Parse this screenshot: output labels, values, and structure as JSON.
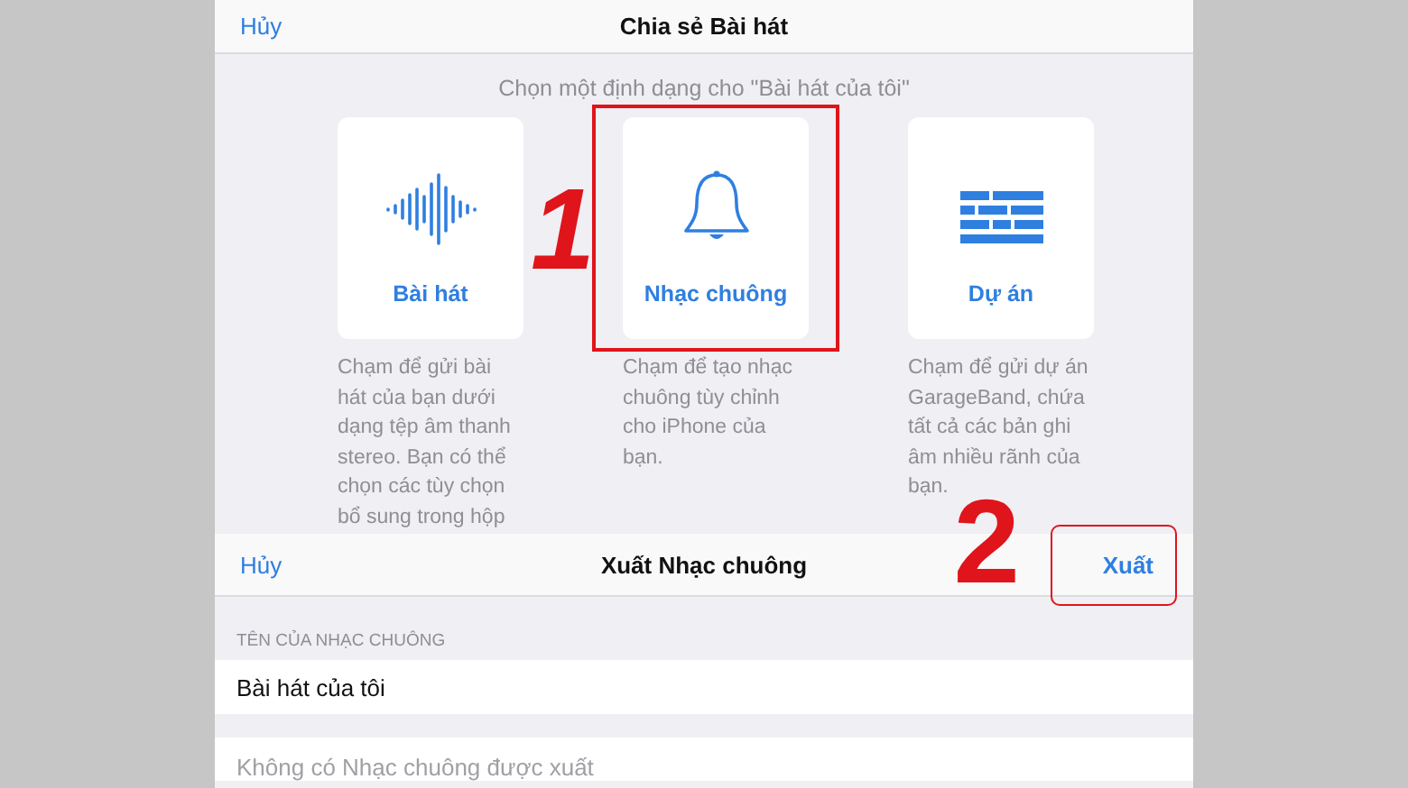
{
  "share_sheet": {
    "cancel": "Hủy",
    "title": "Chia sẻ Bài hát",
    "subtitle": "Chọn một định dạng cho \"Bài hát của tôi\"",
    "formats": [
      {
        "kind": "waveform",
        "label": "Bài hát",
        "description": "Chạm để gửi bài hát của bạn dưới dạng tệp âm thanh stereo. Bạn có thể chọn các tùy chọn bổ sung trong hộp",
        "selected": false
      },
      {
        "kind": "bell",
        "label": "Nhạc chuông",
        "description": "Chạm để tạo nhạc chuông tùy chỉnh cho iPhone của bạn.",
        "selected": true
      },
      {
        "kind": "bricks",
        "label": "Dự án",
        "description": "Chạm để gửi dự án GarageBand, chứa tất cả các bản ghi âm nhiều rãnh của bạn.",
        "selected": false
      }
    ]
  },
  "export_sheet": {
    "cancel": "Hủy",
    "title": "Xuất Nhạc chuông",
    "export": "Xuất",
    "export_highlighted": true,
    "section_header": "TÊN CỦA NHẠC CHUÔNG",
    "name_value": "Bài hát của tôi",
    "footer_text": "Không có Nhạc chuông được xuất"
  },
  "step_labels": [
    "1",
    "2"
  ]
}
